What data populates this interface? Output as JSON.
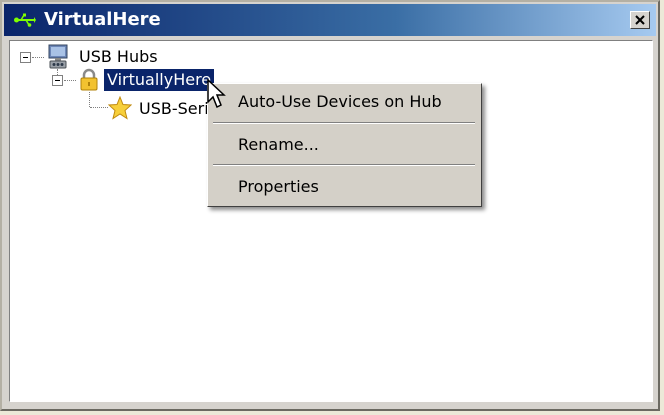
{
  "window": {
    "title": "VirtualHere",
    "title_icon": "usb-icon",
    "close_icon": "close-icon"
  },
  "tree": {
    "root": {
      "label": "USB Hubs",
      "icon": "computer-hub-icon",
      "expanded": true
    },
    "hub": {
      "label": "VirtuallyHere",
      "icon": "lock-icon",
      "expanded": true,
      "selected": true
    },
    "device": {
      "label": "USB-Seri",
      "icon": "star-icon"
    }
  },
  "context_menu": {
    "items": [
      {
        "label": "Auto-Use Devices on Hub"
      },
      {
        "label": "Rename..."
      },
      {
        "label": "Properties"
      }
    ]
  },
  "colors": {
    "selection": "#0a246a",
    "titlebar_start": "#0a246a",
    "titlebar_end": "#a6caf0"
  }
}
